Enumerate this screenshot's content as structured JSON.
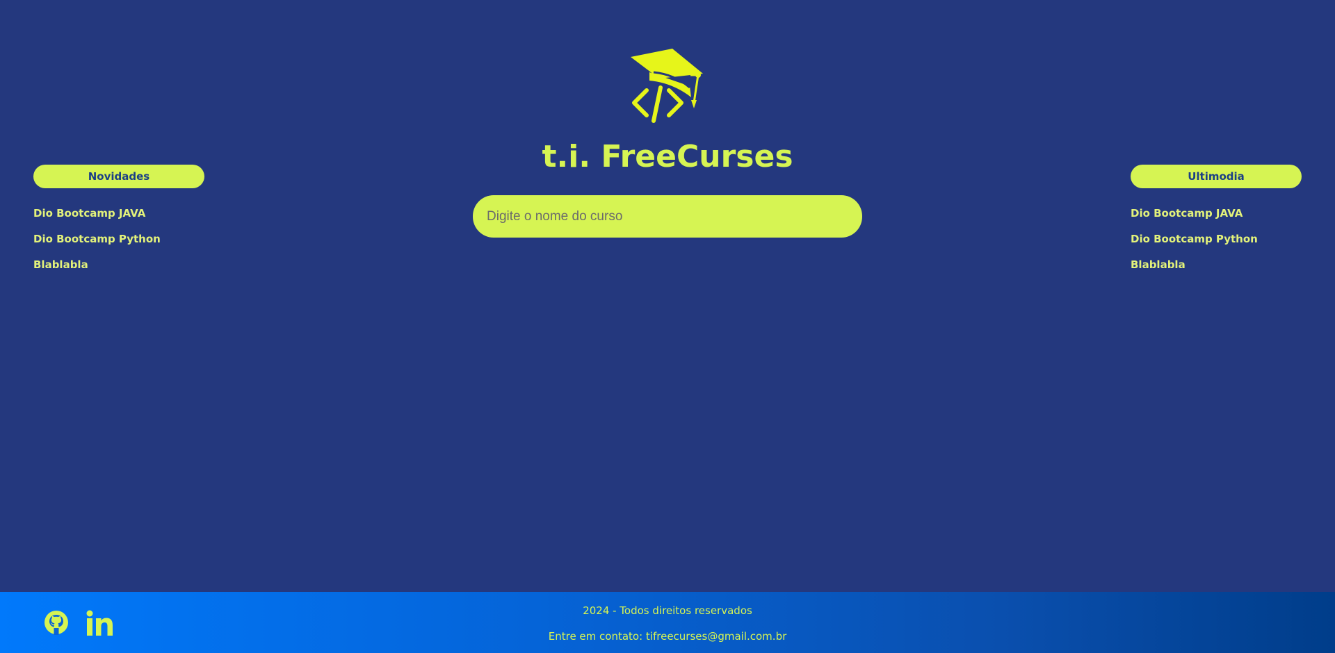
{
  "header": {
    "logo_icon": "graduation-cap-code-icon",
    "title": "t.i. FreeCurses"
  },
  "search": {
    "placeholder": "Digite o nome do curso",
    "value": ""
  },
  "left_panel": {
    "title": "Novidades",
    "items": [
      {
        "label": "Dio Bootcamp JAVA"
      },
      {
        "label": "Dio Bootcamp Python"
      },
      {
        "label": "Blablabla"
      }
    ]
  },
  "right_panel": {
    "title": "Ultimodia",
    "items": [
      {
        "label": "Dio Bootcamp JAVA"
      },
      {
        "label": "Dio Bootcamp Python"
      },
      {
        "label": "Blablabla"
      }
    ]
  },
  "footer": {
    "copyright": "2024 - Todos direitos reservados",
    "contact": "Entre em contato: tifreecurses@gmail.com.br",
    "social": [
      {
        "icon": "github-icon"
      },
      {
        "icon": "linkedin-icon"
      }
    ]
  },
  "colors": {
    "background": "#24387e",
    "accent": "#d6f453",
    "link": "#e3f27a",
    "panel_title_text": "#1b3f86",
    "footer_gradient_start": "#0179fb",
    "footer_gradient_end": "#003d8a"
  }
}
